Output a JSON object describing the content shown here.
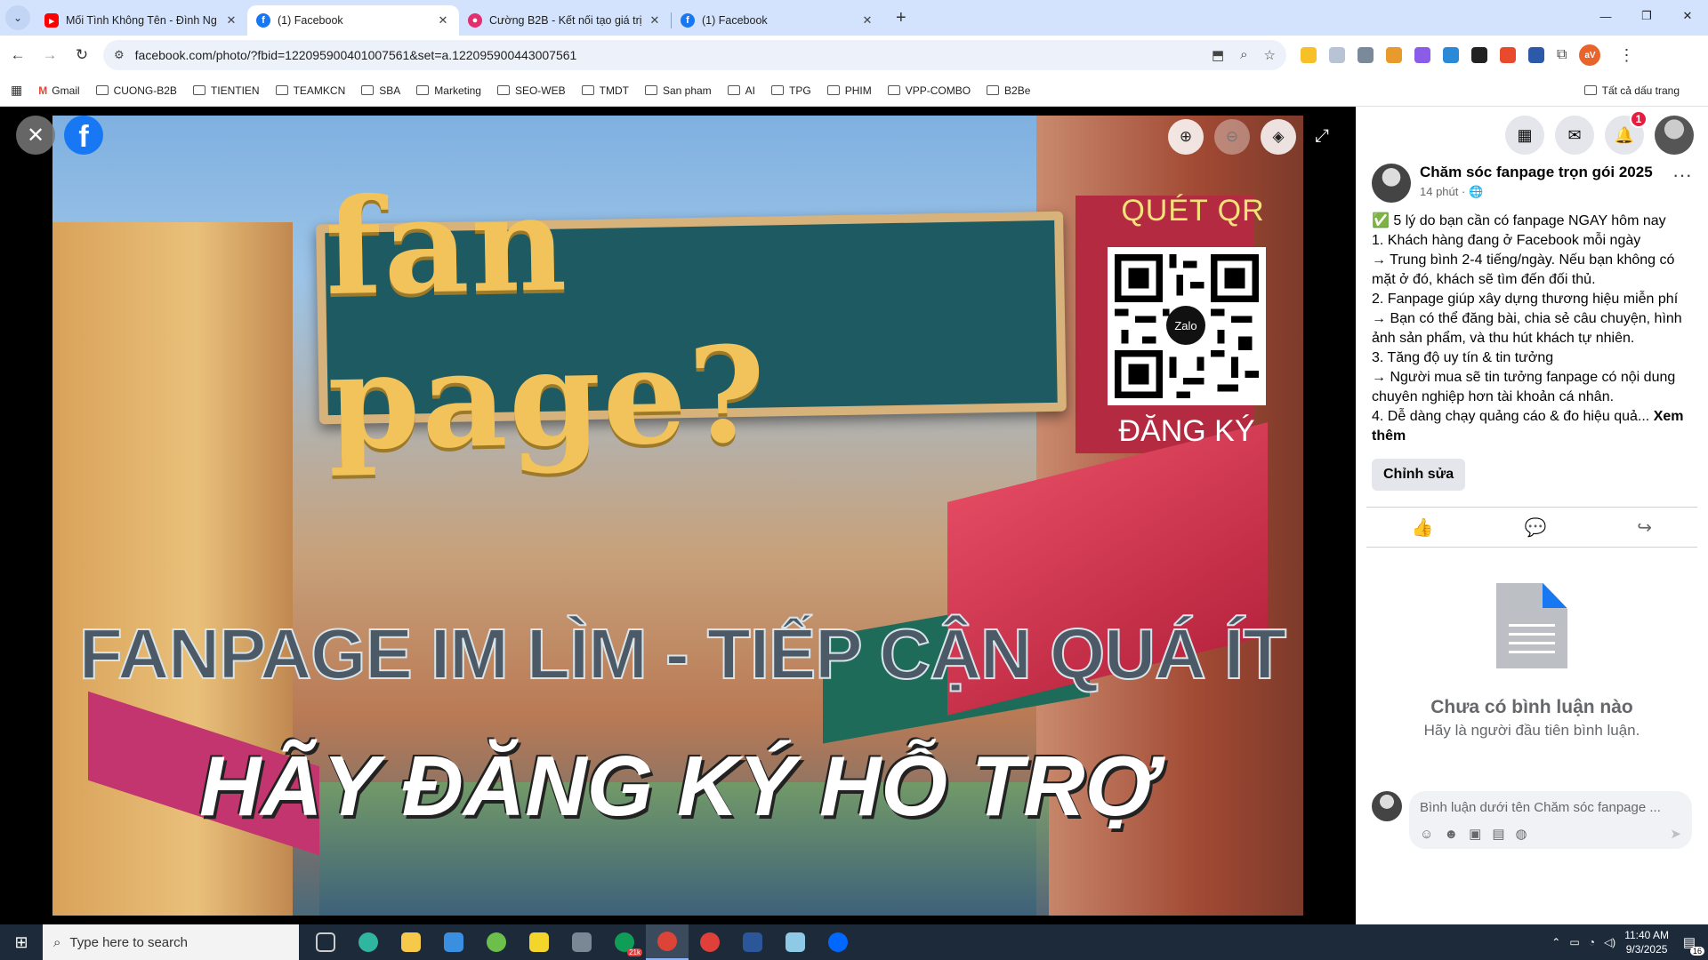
{
  "browser": {
    "tabs": [
      {
        "title": "Mối Tình Không Tên - Đình Ng",
        "favicon": "youtube-icon",
        "active": false
      },
      {
        "title": "(1) Facebook",
        "favicon": "facebook-icon",
        "active": true
      },
      {
        "title": "Cường B2B - Kết nối tạo giá trị",
        "favicon": "b2b-icon",
        "active": false
      },
      {
        "title": "(1) Facebook",
        "favicon": "facebook-icon",
        "active": false
      }
    ],
    "url": "facebook.com/photo/?fbid=122095900401007561&set=a.122095900443007561",
    "profile_initials": "aV",
    "bookmarks": [
      "Gmail",
      "CUONG-B2B",
      "TIENTIEN",
      "TEAMKCN",
      "SBA",
      "Marketing",
      "SEO-WEB",
      "TMDT",
      "San pham",
      "AI",
      "TPG",
      "PHIM",
      "VPP-COMBO",
      "B2Be"
    ],
    "all_bookmarks_label": "Tất cả dấu trang"
  },
  "photo": {
    "sign_text": "fan page?",
    "qr_title": "QUÉT QR",
    "qr_center": "Zalo",
    "qr_subtitle": "ĐĂNG KÝ",
    "headline1": "FANPAGE IM LÌM - TIẾP CẬN QUÁ ÍT",
    "headline2": "HÃY ĐĂNG KÝ HỖ TRỢ"
  },
  "header": {
    "notification_count": "1"
  },
  "post": {
    "author": "Chăm sóc fanpage trọn gói 2025",
    "time": "14 phút ·",
    "lines": [
      "✅ 5 lý do bạn cần có fanpage NGAY hôm nay",
      "1. Khách hàng đang ở Facebook mỗi ngày",
      "→ Trung bình 2-4 tiếng/ngày. Nếu bạn không có mặt ở đó, khách sẽ tìm đến đối thủ.",
      "2. Fanpage giúp xây dựng thương hiệu miễn phí",
      "→ Bạn có thể đăng bài, chia sẻ câu chuyện, hình ảnh sản phẩm, và thu hút khách tự nhiên.",
      "3. Tăng độ uy tín & tin tưởng",
      "→ Người mua sẽ tin tưởng fanpage có nội dung chuyên nghiệp hơn tài khoản cá nhân.",
      "4. Dễ dàng chạy quảng cáo & đo hiệu quả..."
    ],
    "see_more": "Xem thêm",
    "edit_label": "Chỉnh sửa",
    "no_comments_title": "Chưa có bình luận nào",
    "no_comments_sub": "Hãy là người đầu tiên bình luận.",
    "comment_placeholder": "Bình luận dưới tên Chăm sóc fanpage ..."
  },
  "taskbar": {
    "search_placeholder": "Type here to search",
    "time": "11:40 AM",
    "date": "9/3/2025",
    "notif_count": "16",
    "chrome_badge": "21k"
  }
}
